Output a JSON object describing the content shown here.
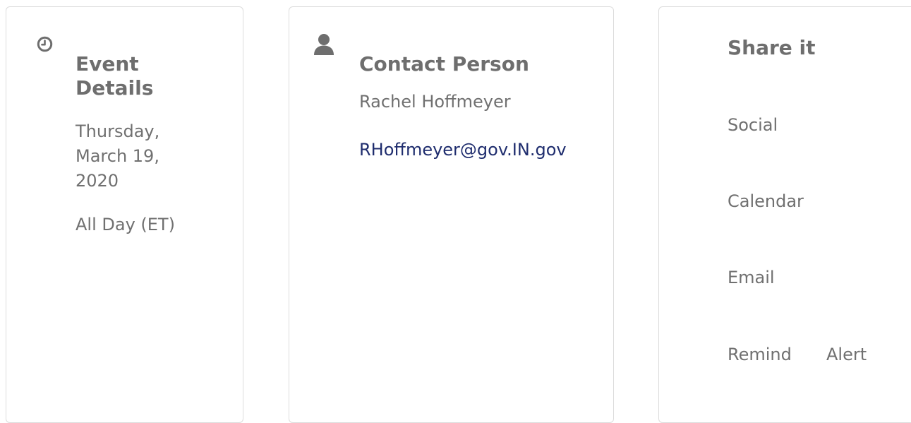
{
  "event_details": {
    "icon": "clock-icon",
    "heading": "Event Details",
    "date": "Thursday, March 19, 2020",
    "time": "All Day (ET)"
  },
  "contact_person": {
    "icon": "user-icon",
    "heading": "Contact Person",
    "name": "Rachel Hoffmeyer",
    "email": "RHoffmeyer@gov.IN.gov"
  },
  "share": {
    "heading": "Share it",
    "social_label": "Social",
    "calendar_label": "Calendar",
    "email_label": "Email",
    "remind_label": "Remind",
    "alert_label": "Alert"
  },
  "colors": {
    "text_gray": "#707070",
    "link_navy": "#1f2d6e",
    "icon_gray": "#6e6e6e",
    "card_border": "#dcdcdc"
  }
}
